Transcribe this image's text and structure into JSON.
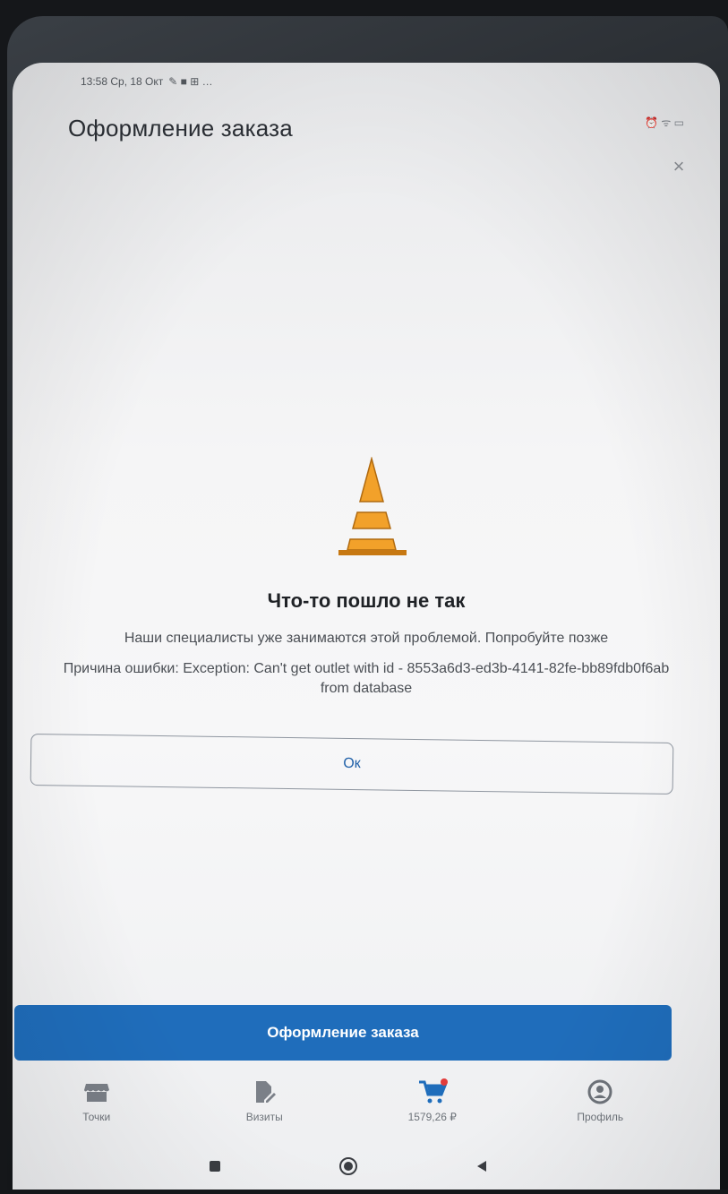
{
  "statusbar": {
    "time_date": "13:58 Ср, 18 Окт",
    "icons_left": "✎ ■ ⊞ …",
    "icons_right": "⏰ ᯤ ▭"
  },
  "header": {
    "title": "Оформление заказа",
    "close_glyph": "×"
  },
  "error": {
    "title": "Что-то пошло не так",
    "subtitle": "Наши специалисты уже занимаются этой проблемой. Попробуйте позже",
    "reason": "Причина ошибки: Exception: Can't get outlet with id - 8553a6d3-ed3b-4141-82fe-bb89fdb0f6ab from database",
    "ok_label": "Ок"
  },
  "primary_button": {
    "label": "Оформление заказа"
  },
  "bottom_nav": [
    {
      "label": "Точки",
      "icon": "store-icon"
    },
    {
      "label": "Визиты",
      "icon": "edit-document-icon"
    },
    {
      "label": "1579,26 ₽",
      "icon": "cart-icon"
    },
    {
      "label": "Профиль",
      "icon": "user-icon"
    }
  ],
  "colors": {
    "accent": "#1f6dbb",
    "cone": "#f2a12a",
    "cart_dot": "#e23b3b"
  }
}
